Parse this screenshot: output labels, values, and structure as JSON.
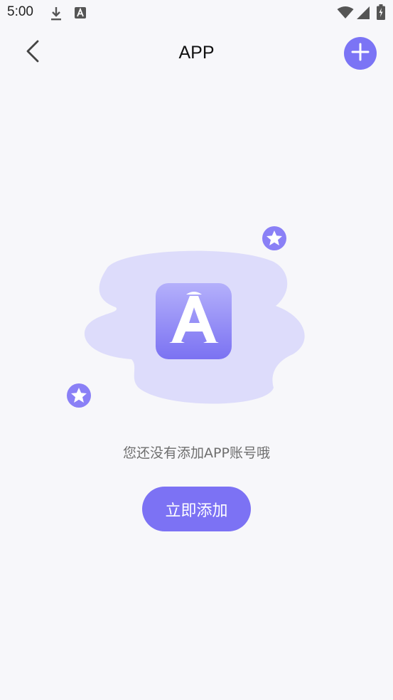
{
  "status_bar": {
    "time": "5:00",
    "left_icons": [
      "download-icon",
      "a-app-icon"
    ],
    "right_icons": [
      "wifi-icon",
      "cellular-signal-icon",
      "battery-charging-icon"
    ]
  },
  "app_bar": {
    "title": "APP",
    "back_icon": "chevron-left-icon",
    "add_icon": "plus-icon"
  },
  "empty_state": {
    "illustration_icon": "a-app-icon",
    "decoration_icons": [
      "star-badge-icon",
      "star-badge-icon"
    ],
    "message": "您还没有添加APP账号哦",
    "button_label": "立即添加"
  },
  "colors": {
    "accent": "#7b74f5",
    "blob": "#dddcfb",
    "background": "#f7f7fa",
    "message_text": "#6e6e6e"
  }
}
